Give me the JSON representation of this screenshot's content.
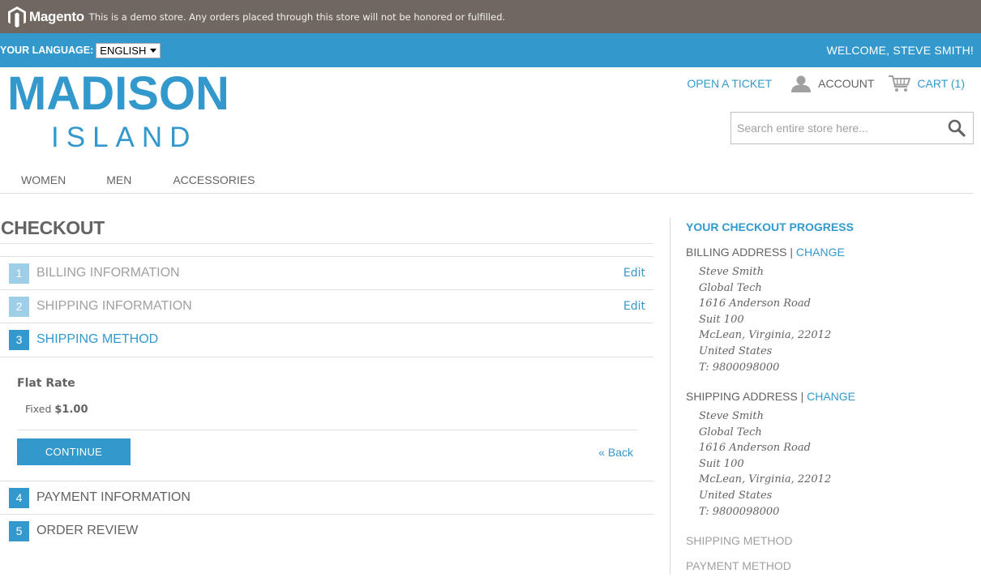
{
  "demo_bar": {
    "logo_text": "Magento",
    "notice": "This is a demo store. Any orders placed through this store will not be honored or fulfilled."
  },
  "lang_bar": {
    "label": "YOUR LANGUAGE:",
    "selected_language": "ENGLISH",
    "welcome": "WELCOME, STEVE SMITH!"
  },
  "header": {
    "logo_line1": "MADISON",
    "logo_line2": "ISLAND",
    "open_ticket": "OPEN A TICKET",
    "account": "ACCOUNT",
    "cart": "CART (1)",
    "search_placeholder": "Search entire store here..."
  },
  "nav": {
    "items": [
      "WOMEN",
      "MEN",
      "ACCESSORIES"
    ]
  },
  "checkout": {
    "title": "CHECKOUT",
    "steps": [
      {
        "num": "1",
        "label": "BILLING INFORMATION",
        "edit": "Edit"
      },
      {
        "num": "2",
        "label": "SHIPPING INFORMATION",
        "edit": "Edit"
      },
      {
        "num": "3",
        "label": "SHIPPING METHOD"
      },
      {
        "num": "4",
        "label": "PAYMENT INFORMATION"
      },
      {
        "num": "5",
        "label": "ORDER REVIEW"
      }
    ],
    "shipping_method": {
      "name": "Flat Rate",
      "option_label": "Fixed",
      "price": "$1.00",
      "continue": "CONTINUE",
      "back": "« Back"
    }
  },
  "progress": {
    "title": "YOUR CHECKOUT PROGRESS",
    "billing_label": "BILLING ADDRESS",
    "shipping_label": "SHIPPING ADDRESS",
    "separator": "|",
    "change": "CHANGE",
    "billing_address": [
      "Steve Smith",
      "Global Tech",
      "1616 Anderson Road",
      "Suit 100",
      "McLean, Virginia, 22012",
      "United States",
      "T: 9800098000"
    ],
    "shipping_address": [
      "Steve Smith",
      "Global Tech",
      "1616 Anderson Road",
      "Suit 100",
      "McLean, Virginia, 22012",
      "United States",
      "T: 9800098000"
    ],
    "shipping_method_label": "SHIPPING METHOD",
    "payment_method_label": "PAYMENT METHOD"
  },
  "colors": {
    "brand_blue": "#3399cc",
    "demo_bar": "#6f6760",
    "text": "#636363"
  }
}
